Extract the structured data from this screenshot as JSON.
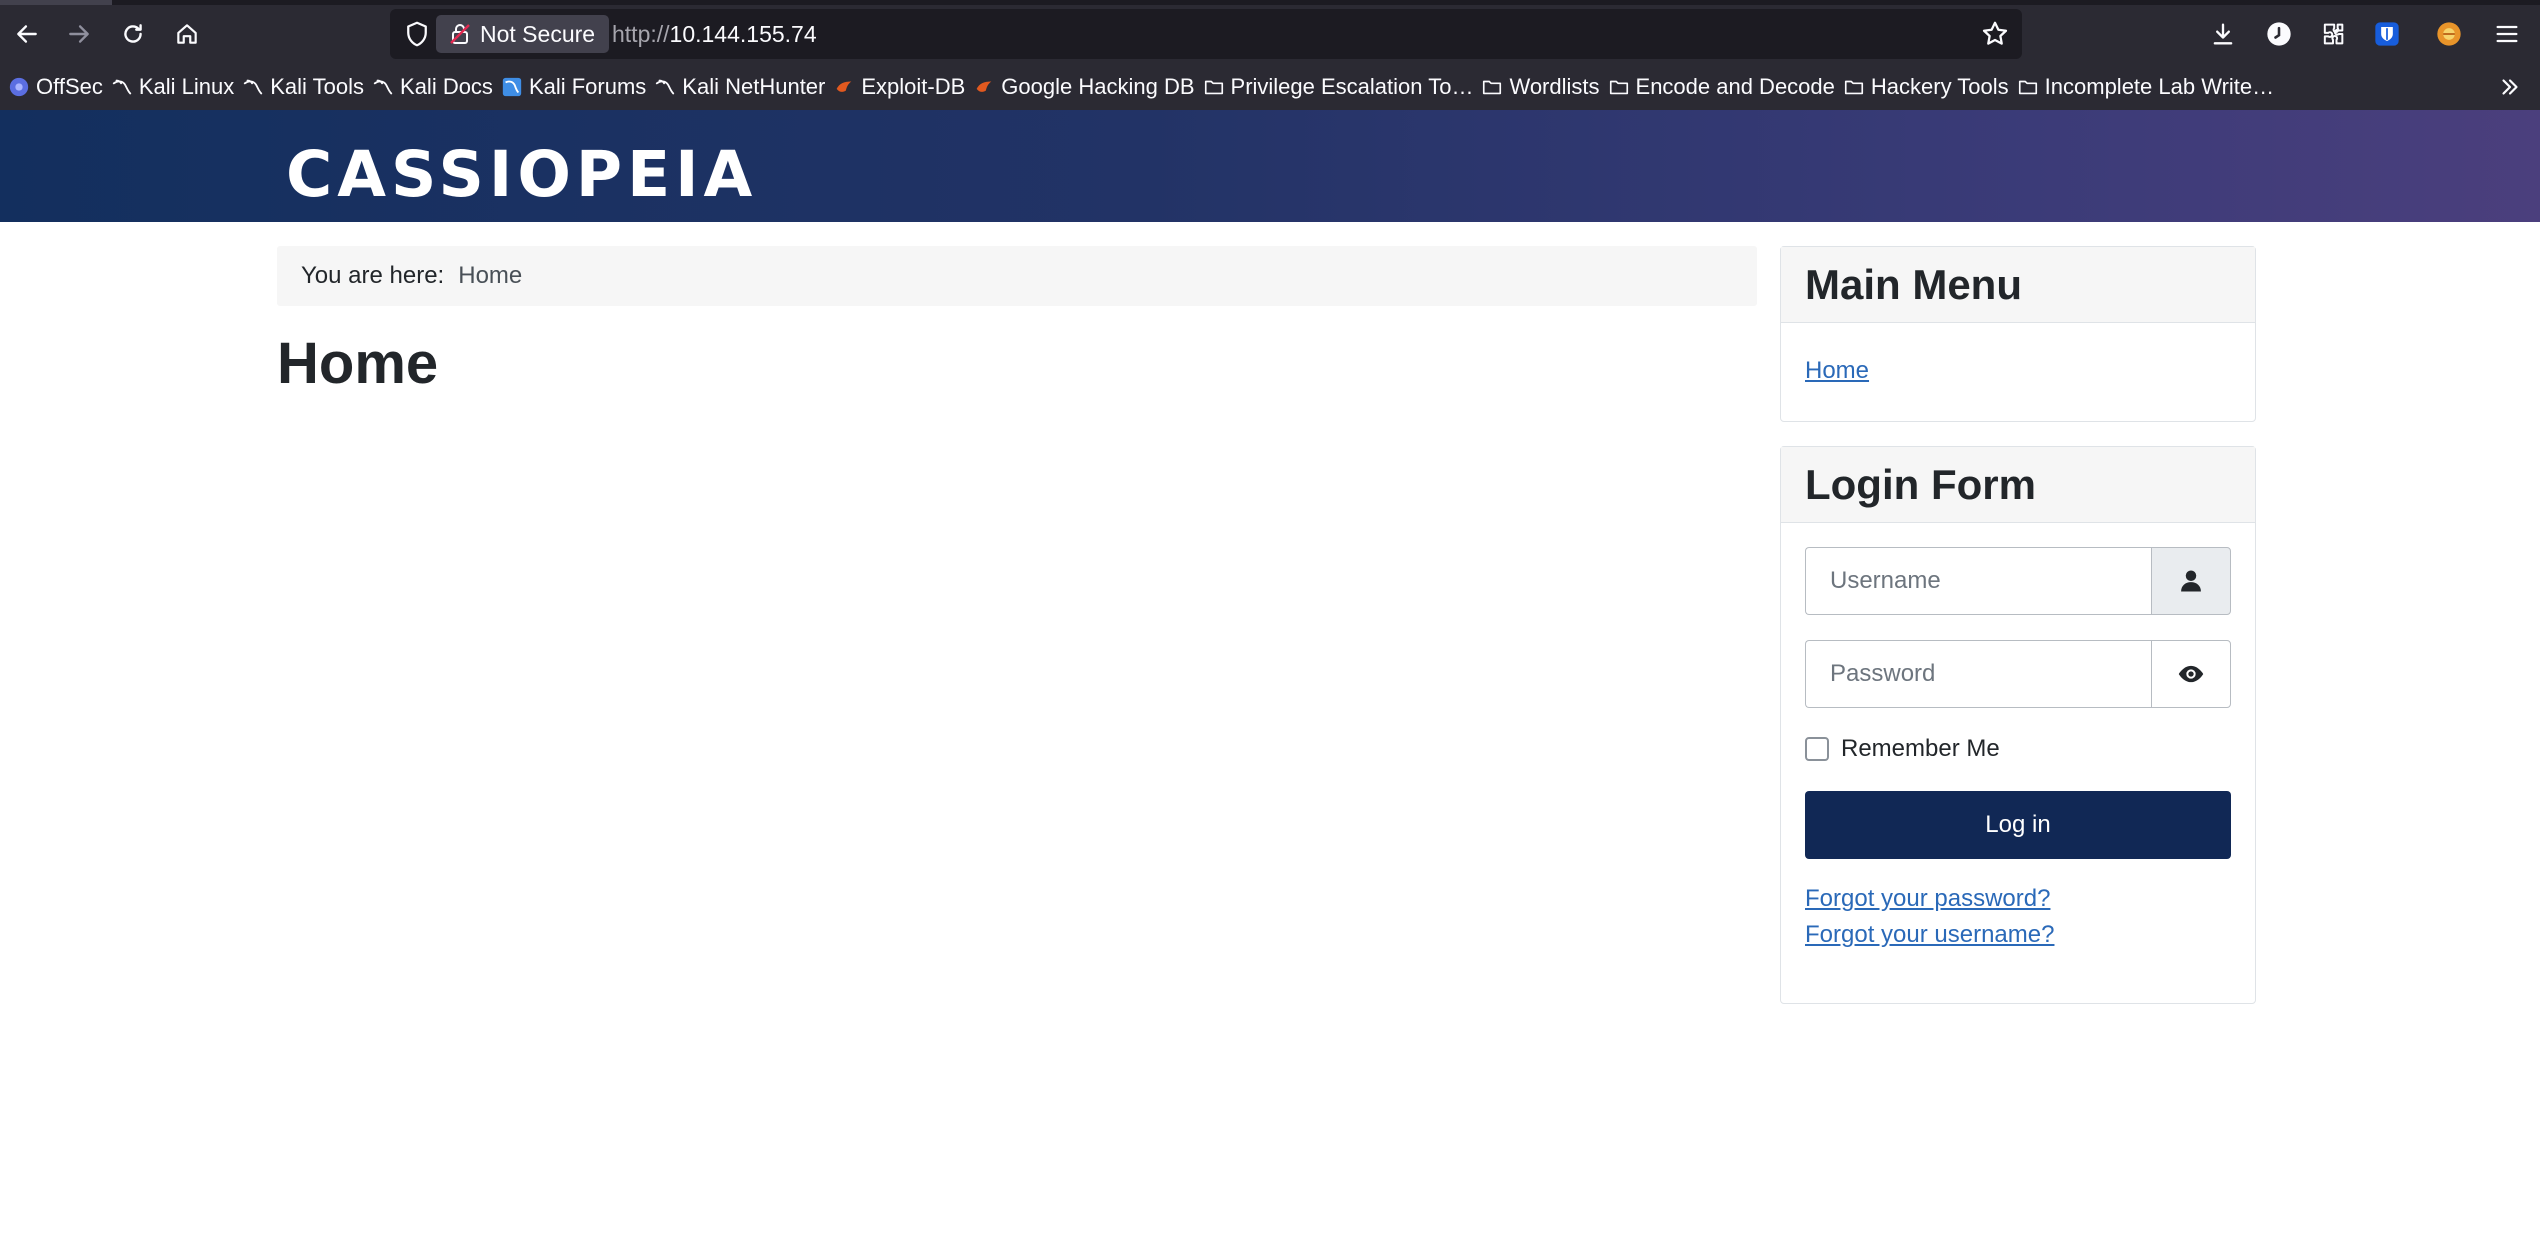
{
  "browser": {
    "security_label": "Not Secure",
    "url_protocol": "http://",
    "url_host": "10.144.155.74",
    "bookmarks": [
      {
        "label": "OffSec",
        "icon": "offsec-icon"
      },
      {
        "label": "Kali Linux",
        "icon": "kali-dragon-icon"
      },
      {
        "label": "Kali Tools",
        "icon": "kali-dragon-icon"
      },
      {
        "label": "Kali Docs",
        "icon": "kali-dragon-icon"
      },
      {
        "label": "Kali Forums",
        "icon": "kali-forums-icon"
      },
      {
        "label": "Kali NetHunter",
        "icon": "kali-dragon-icon"
      },
      {
        "label": "Exploit-DB",
        "icon": "exploit-db-icon"
      },
      {
        "label": "Google Hacking DB",
        "icon": "exploit-db-icon"
      },
      {
        "label": "Privilege Escalation To…",
        "icon": "folder-icon"
      },
      {
        "label": "Wordlists",
        "icon": "folder-icon"
      },
      {
        "label": "Encode and Decode",
        "icon": "folder-icon"
      },
      {
        "label": "Hackery Tools",
        "icon": "folder-icon"
      },
      {
        "label": "Incomplete Lab Write…",
        "icon": "folder-icon"
      }
    ]
  },
  "site": {
    "brand": "CASSIOPEIA",
    "breadcrumb_label": "You are here:",
    "breadcrumb_item": "Home",
    "page_title": "Home"
  },
  "sidebar": {
    "main_menu": {
      "title": "Main Menu",
      "items": [
        {
          "label": "Home"
        }
      ]
    },
    "login_form": {
      "title": "Login Form",
      "username_placeholder": "Username",
      "password_placeholder": "Password",
      "remember_label": "Remember Me",
      "login_label": "Log in",
      "forgot_password": "Forgot your password?",
      "forgot_username": "Forgot your username?"
    }
  },
  "colors": {
    "chrome_bg": "#2b2a33",
    "urlbar_bg": "#1c1b22",
    "header_start": "#132f5e",
    "header_end": "#4b3f7d",
    "button_bg": "#112855",
    "link": "#2a69b8"
  }
}
